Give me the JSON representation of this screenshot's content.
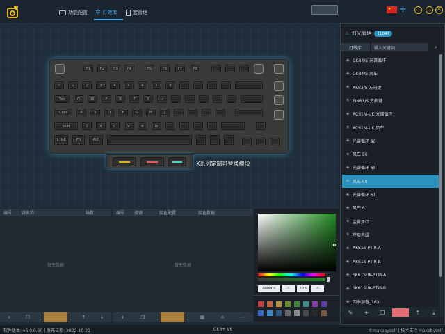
{
  "topbar": {
    "tabs": [
      {
        "label": "功能配置",
        "icon": "keyboard-icon",
        "active": false
      },
      {
        "label": "灯效库",
        "icon": "gear-icon",
        "active": true
      },
      {
        "label": "宏管理",
        "icon": "document-icon",
        "active": false
      }
    ]
  },
  "keyboard": {
    "row0": [
      "F1",
      "F2",
      "F3",
      "F4",
      "F5",
      "F6",
      "F7",
      "F8"
    ],
    "row1": [
      "~",
      "1",
      "2",
      "3",
      "4",
      "5",
      "6",
      "7",
      "8"
    ],
    "row2": [
      "Tab",
      "Q",
      "W",
      "E",
      "R",
      "T",
      "Y",
      "U"
    ],
    "row3": [
      "Caps",
      "A",
      "S",
      "D",
      "F",
      "G",
      "H",
      "J"
    ],
    "row4": [
      "Shift",
      "Z",
      "X",
      "C",
      "V",
      "B",
      "N"
    ],
    "row5": [
      "CTRL",
      "Fn",
      "ALT"
    ],
    "module_label": "X系列定制可替换模块"
  },
  "panel_keys": {
    "headers": [
      "编号",
      "键名称",
      "轴数"
    ],
    "empty": "暂无数据"
  },
  "panel_colors": {
    "headers": [
      "编号",
      "按键",
      "颜色配置",
      "颜色数据"
    ],
    "empty": "暂无数据"
  },
  "color_picker": {
    "hex": "008000",
    "r": "0",
    "g": "128",
    "b": "0",
    "swatches_row1": [
      "#c73a3a",
      "#c0623a",
      "#b58f3a",
      "#6b8a2e",
      "#3e8a3a",
      "#3a8a8a",
      "#8a3aa8",
      "#5a3aa8"
    ],
    "swatches_row2": [
      "#3a6ac7",
      "#3a88c7",
      "#2e5a8a",
      "#6a6a6a",
      "#8a8a8a",
      "#4a4a4a",
      "#2a2a2a",
      "#7a5a3a"
    ]
  },
  "lighting_library": {
    "title": "灯光管理",
    "count": "164",
    "tab_label": "灯效库",
    "search_placeholder": "输入关键词",
    "items": [
      "GK84/S 光谱循环",
      "GK84/S 风车",
      "AK63/S 方向键",
      "FIN61/S 方向键",
      "AC61M-UK 光谱循环",
      "AC61M-UK 风车",
      "光谱循环 96",
      "风车 96",
      "光谱循环 68",
      "风车 68",
      "光谱循环 61",
      "风车 61",
      "金黄泽红",
      "呼吸春绿",
      "AK61S-PTIR-A",
      "AK61S-PTIR-B",
      "SK61SUK-PTIR-A",
      "SK61SUK-PTIR-B",
      "四季加春_163"
    ],
    "selected_index": 9,
    "footer_buttons": [
      "✎",
      "+",
      "❐",
      "",
      "⇡",
      "⇣"
    ]
  },
  "statusbar": {
    "left": "软件版本: v6.0.0.60 | 发布日期: 2022-10-21",
    "center": "GK6+ V6",
    "right": "©makebyself | 技术支持 makebyself"
  },
  "colors": {
    "accent": "#4aa8e8",
    "selected": "#2b92be",
    "orange_button": "#a9803a",
    "pink_button": "#e46a74"
  }
}
